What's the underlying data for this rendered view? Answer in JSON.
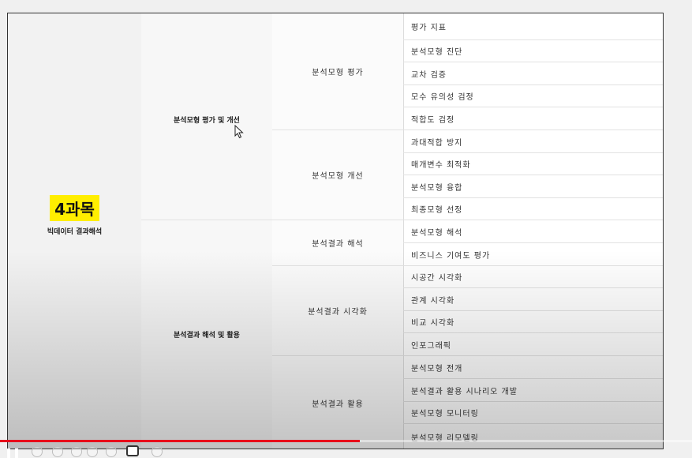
{
  "course": {
    "label": "4과목",
    "subtitle": "빅데이터 결과해석"
  },
  "groups": [
    {
      "label": "분석모형 평가 및 개선"
    },
    {
      "label": "분석결과 해석 및 활용"
    }
  ],
  "subgroups": [
    {
      "label": "분석모형 평가"
    },
    {
      "label": "분석모형 개선"
    },
    {
      "label": "분석결과 해석"
    },
    {
      "label": "분석결과 시각화"
    },
    {
      "label": "분석결과 활용"
    }
  ],
  "items": [
    "평가 지표",
    "분석모형 진단",
    "교차 검증",
    "모수 유의성 검정",
    "적합도 검정",
    "과대적합 방지",
    "매개변수 최적화",
    "분석모형 융합",
    "최종모형 선정",
    "분석모형 해석",
    "비즈니스 기여도 평가",
    "시공간 시각화",
    "관계 시각화",
    "비교 시각화",
    "인포그래픽",
    "분석모형 전개",
    "분석결과 활용 시나리오 개발",
    "분석모형 모니터링",
    "분석모형 리모델링"
  ],
  "player": {
    "progress_fraction": 0.52,
    "progress_color": "#e8001a",
    "play_icon": "pause-icon"
  }
}
